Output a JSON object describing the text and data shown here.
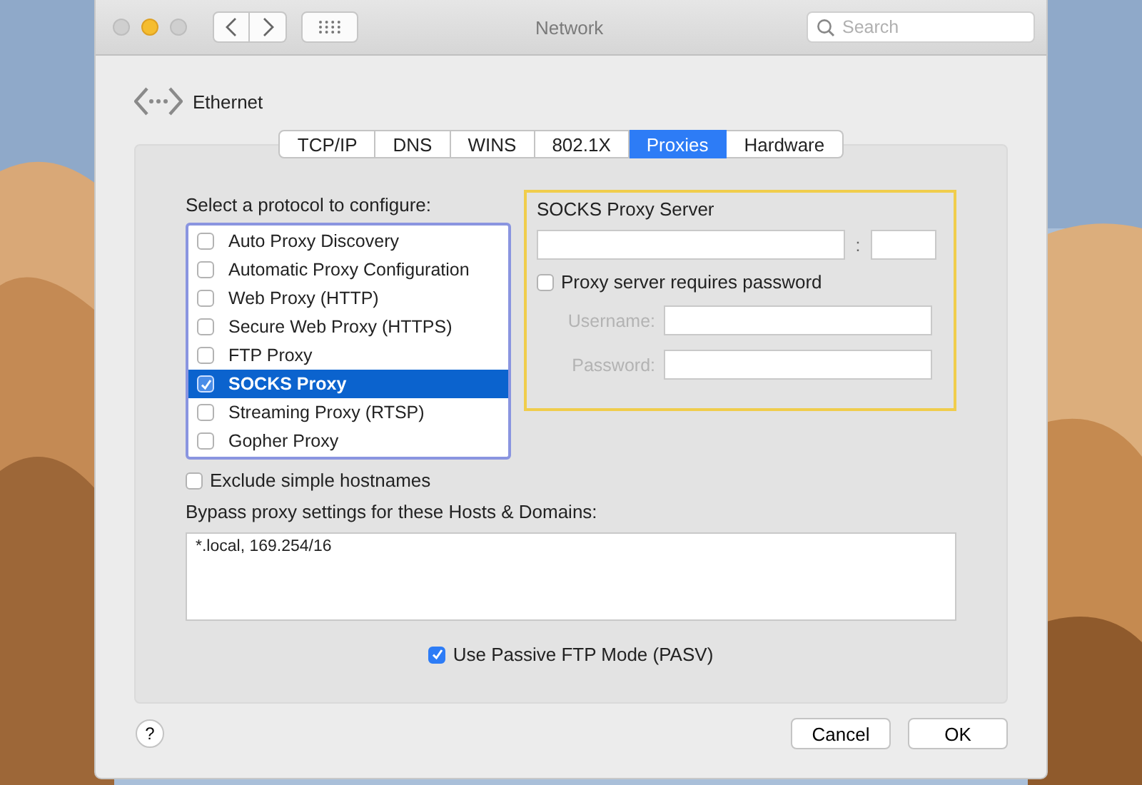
{
  "window": {
    "title": "Network"
  },
  "search": {
    "placeholder": "Search"
  },
  "interface": {
    "name": "Ethernet"
  },
  "tabs": [
    {
      "label": "TCP/IP",
      "selected": false
    },
    {
      "label": "DNS",
      "selected": false
    },
    {
      "label": "WINS",
      "selected": false
    },
    {
      "label": "802.1X",
      "selected": false
    },
    {
      "label": "Proxies",
      "selected": true
    },
    {
      "label": "Hardware",
      "selected": false
    }
  ],
  "protocols": {
    "label": "Select a protocol to configure:",
    "items": [
      {
        "label": "Auto Proxy Discovery",
        "checked": false,
        "selected": false
      },
      {
        "label": "Automatic Proxy Configuration",
        "checked": false,
        "selected": false
      },
      {
        "label": "Web Proxy (HTTP)",
        "checked": false,
        "selected": false
      },
      {
        "label": "Secure Web Proxy (HTTPS)",
        "checked": false,
        "selected": false
      },
      {
        "label": "FTP Proxy",
        "checked": false,
        "selected": false
      },
      {
        "label": "SOCKS Proxy",
        "checked": true,
        "selected": true
      },
      {
        "label": "Streaming Proxy (RTSP)",
        "checked": false,
        "selected": false
      },
      {
        "label": "Gopher Proxy",
        "checked": false,
        "selected": false
      }
    ]
  },
  "server": {
    "title": "SOCKS Proxy Server",
    "separator": ":",
    "requires_password": {
      "label": "Proxy server requires password",
      "checked": false
    },
    "credentials": [
      {
        "label": "Username:",
        "disabled": true
      },
      {
        "label": "Password:",
        "disabled": true
      }
    ]
  },
  "exclude_simple": {
    "label": "Exclude simple hostnames",
    "checked": false
  },
  "bypass": {
    "label": "Bypass proxy settings for these Hosts & Domains:",
    "value": "*.local, 169.254/16"
  },
  "passive_ftp": {
    "label": "Use Passive FTP Mode (PASV)",
    "checked": true
  },
  "help": "?",
  "buttons": [
    "Cancel",
    "OK"
  ]
}
